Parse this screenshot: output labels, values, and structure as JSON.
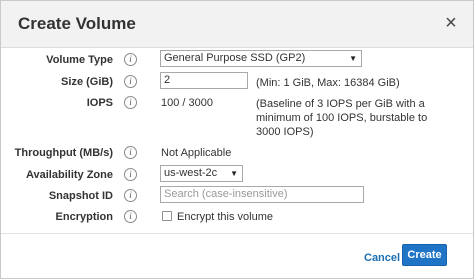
{
  "dialog": {
    "title": "Create Volume",
    "close_glyph": "×"
  },
  "fields": {
    "volume_type": {
      "label": "Volume Type",
      "value": "General Purpose SSD (GP2)"
    },
    "size": {
      "label": "Size (GiB)",
      "value": "2",
      "hint": "(Min: 1 GiB, Max: 16384 GiB)"
    },
    "iops": {
      "label": "IOPS",
      "value": "100 / 3000",
      "hint_line1": "(Baseline of 3 IOPS per GiB with a",
      "hint_line2": "minimum of 100 IOPS, burstable to",
      "hint_line3": "3000 IOPS)"
    },
    "throughput": {
      "label": "Throughput (MB/s)",
      "value": "Not Applicable"
    },
    "availability_zone": {
      "label": "Availability Zone",
      "value": "us-west-2c"
    },
    "snapshot_id": {
      "label": "Snapshot ID",
      "placeholder": "Search (case-insensitive)"
    },
    "encryption": {
      "label": "Encryption",
      "checkbox_label": "Encrypt this volume",
      "checked": false
    }
  },
  "icons": {
    "info": "i",
    "caret": "▼"
  },
  "footer": {
    "cancel_label": "Cancel",
    "create_label": "Create"
  },
  "colors": {
    "primary": "#1f74c6",
    "link": "#1a6fb5",
    "header_bg": "#f2f2f2"
  }
}
